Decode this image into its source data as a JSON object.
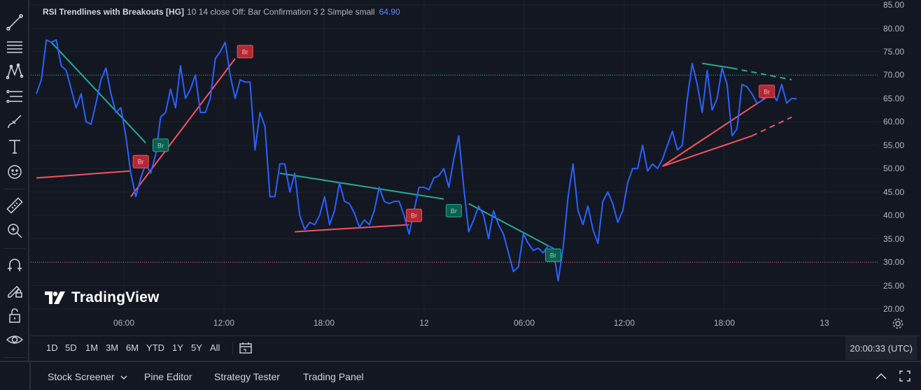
{
  "legend": {
    "name": "RSI Trendlines with Breakouts [HG]",
    "params": "10 14 close Off: Bar Confirmation 3 2 Simple small",
    "value": "64.90"
  },
  "logo": {
    "text": "TradingView"
  },
  "toolbar": {
    "tools": [
      "cursor-line-icon",
      "horizontal-lines-icon",
      "pattern-icon",
      "fib-icon",
      "brush-icon",
      "text-icon",
      "emoji-icon",
      "ruler-icon",
      "zoom-in-icon",
      "magnet-icon",
      "pencil-lock-icon",
      "lock-icon",
      "eye-icon",
      "trash-icon"
    ]
  },
  "price_scale": {
    "labels": [
      "85.00",
      "80.00",
      "75.00",
      "70.00",
      "65.00",
      "60.00",
      "55.00",
      "50.00",
      "45.00",
      "40.00",
      "35.00",
      "30.00",
      "25.00",
      "20.00"
    ]
  },
  "time_scale": {
    "labels": [
      "06:00",
      "12:00",
      "18:00",
      "12",
      "06:00",
      "12:00",
      "18:00",
      "13"
    ]
  },
  "range_bar": {
    "buttons": [
      "1D",
      "5D",
      "1M",
      "3M",
      "6M",
      "YTD",
      "1Y",
      "5Y",
      "All"
    ],
    "clock": "20:00:33 (UTC)"
  },
  "bottom_tabs": {
    "stock_screener": "Stock Screener",
    "pine_editor": "Pine Editor",
    "strategy_tester": "Strategy Tester",
    "trading_panel": "Trading Panel"
  },
  "colors": {
    "background": "#131722",
    "rsi_line": "#2962ff",
    "resistance_trend": "#22ab94",
    "support_trend": "#f7525f",
    "upper_band": "#22ab94",
    "lower_band": "#f7525f"
  },
  "chart_data": {
    "type": "line",
    "title": "RSI Trendlines with Breakouts [HG]",
    "ylim": [
      20,
      85
    ],
    "y_ticks": [
      85,
      80,
      75,
      70,
      65,
      60,
      55,
      50,
      45,
      40,
      35,
      30,
      25,
      20
    ],
    "bands": {
      "upper": 70,
      "lower": 30
    },
    "x_ticks": [
      "06:00",
      "12:00",
      "18:00",
      "12",
      "06:00",
      "12:00",
      "18:00",
      "13"
    ],
    "series": [
      {
        "values": [
          66,
          69,
          77.5,
          77,
          77.5,
          72,
          71,
          67,
          63,
          66,
          60,
          59.5,
          64,
          69,
          71.5,
          66,
          62,
          63,
          57,
          49,
          44,
          48,
          51,
          49,
          53,
          61,
          62,
          67,
          63,
          72,
          65,
          67,
          70,
          62,
          62,
          65,
          73.5,
          75,
          77,
          70,
          65,
          69,
          68.5,
          68.5,
          54,
          62,
          59,
          44,
          44,
          51,
          51,
          45,
          49,
          40,
          37,
          38.5,
          38,
          40,
          44,
          38,
          41,
          47,
          43,
          42.5,
          40.5,
          37.5,
          39,
          38,
          41,
          46,
          43,
          42.5,
          43,
          43,
          40,
          36,
          41,
          46,
          46,
          45.5,
          48,
          48.5,
          50,
          46,
          52,
          57,
          46,
          36.5,
          39,
          42,
          40,
          35,
          41,
          38,
          36,
          32,
          28,
          29,
          36,
          34,
          32.5,
          33,
          32,
          33.5,
          33,
          26,
          33,
          44,
          51,
          41,
          38,
          42,
          37,
          34,
          43,
          45,
          42.5,
          38.5,
          41,
          47,
          50,
          50,
          55,
          49.5,
          51,
          50,
          52,
          55,
          58,
          54,
          55,
          65,
          72.5,
          68,
          62,
          71,
          62.5,
          65,
          71.5,
          68,
          57,
          58.5,
          68,
          67.5,
          66,
          64,
          64.5,
          67,
          66.5,
          64.5,
          68,
          64,
          65,
          64.9
        ]
      }
    ],
    "trendlines": [
      {
        "kind": "resistance",
        "points": [
          [
            3,
            77
          ],
          [
            22,
            55.5
          ]
        ]
      },
      {
        "kind": "support",
        "points": [
          [
            0,
            48
          ],
          [
            19,
            49.5
          ]
        ]
      },
      {
        "kind": "support",
        "points": [
          [
            19,
            44
          ],
          [
            40,
            73.5
          ]
        ]
      },
      {
        "kind": "resistance",
        "points": [
          [
            49,
            49
          ],
          [
            82,
            43.5
          ]
        ]
      },
      {
        "kind": "support",
        "points": [
          [
            52,
            36.5
          ],
          [
            75,
            38
          ]
        ]
      },
      {
        "kind": "resistance",
        "points": [
          [
            87,
            42.5
          ],
          [
            103,
            33.5
          ]
        ]
      },
      {
        "kind": "support",
        "points": [
          [
            126,
            50.5
          ],
          [
            148,
            66
          ]
        ]
      },
      {
        "kind": "support",
        "points": [
          [
            126,
            50.5
          ],
          [
            144,
            57
          ]
        ]
      },
      {
        "kind": "resistance",
        "points": [
          [
            134,
            72.5
          ],
          [
            140,
            71.5
          ]
        ]
      }
    ],
    "projections": [
      {
        "kind": "resistance",
        "points": [
          [
            140,
            71.5
          ],
          [
            152,
            69
          ]
        ]
      },
      {
        "kind": "support",
        "points": [
          [
            144,
            57
          ],
          [
            152,
            61
          ]
        ]
      }
    ],
    "breakouts": [
      {
        "label": "Br",
        "kind": "support",
        "at": [
          21,
          51.5
        ]
      },
      {
        "label": "Br",
        "kind": "resistance",
        "at": [
          25,
          55
        ]
      },
      {
        "label": "Br",
        "kind": "support",
        "at": [
          42,
          75
        ]
      },
      {
        "label": "Br",
        "kind": "support",
        "at": [
          76,
          40
        ]
      },
      {
        "label": "Br",
        "kind": "resistance",
        "at": [
          84,
          41
        ]
      },
      {
        "label": "Br",
        "kind": "resistance",
        "at": [
          104,
          31.5
        ]
      },
      {
        "label": "Br",
        "kind": "support",
        "at": [
          147,
          66.5
        ]
      }
    ]
  }
}
